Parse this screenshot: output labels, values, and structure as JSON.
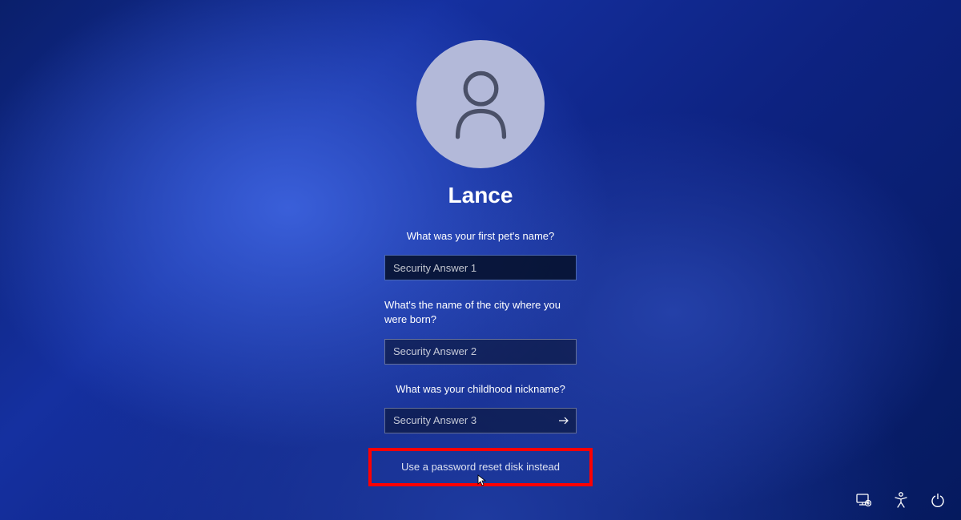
{
  "user": {
    "name": "Lance"
  },
  "security_questions": [
    {
      "question": "What was your first pet's name?",
      "placeholder": "Security Answer 1"
    },
    {
      "question": "What's the name of the city where you were born?",
      "placeholder": "Security Answer 2"
    },
    {
      "question": "What was your childhood nickname?",
      "placeholder": "Security Answer 3"
    }
  ],
  "reset_link": "Use a password reset disk instead",
  "highlight_color": "#ff0000"
}
